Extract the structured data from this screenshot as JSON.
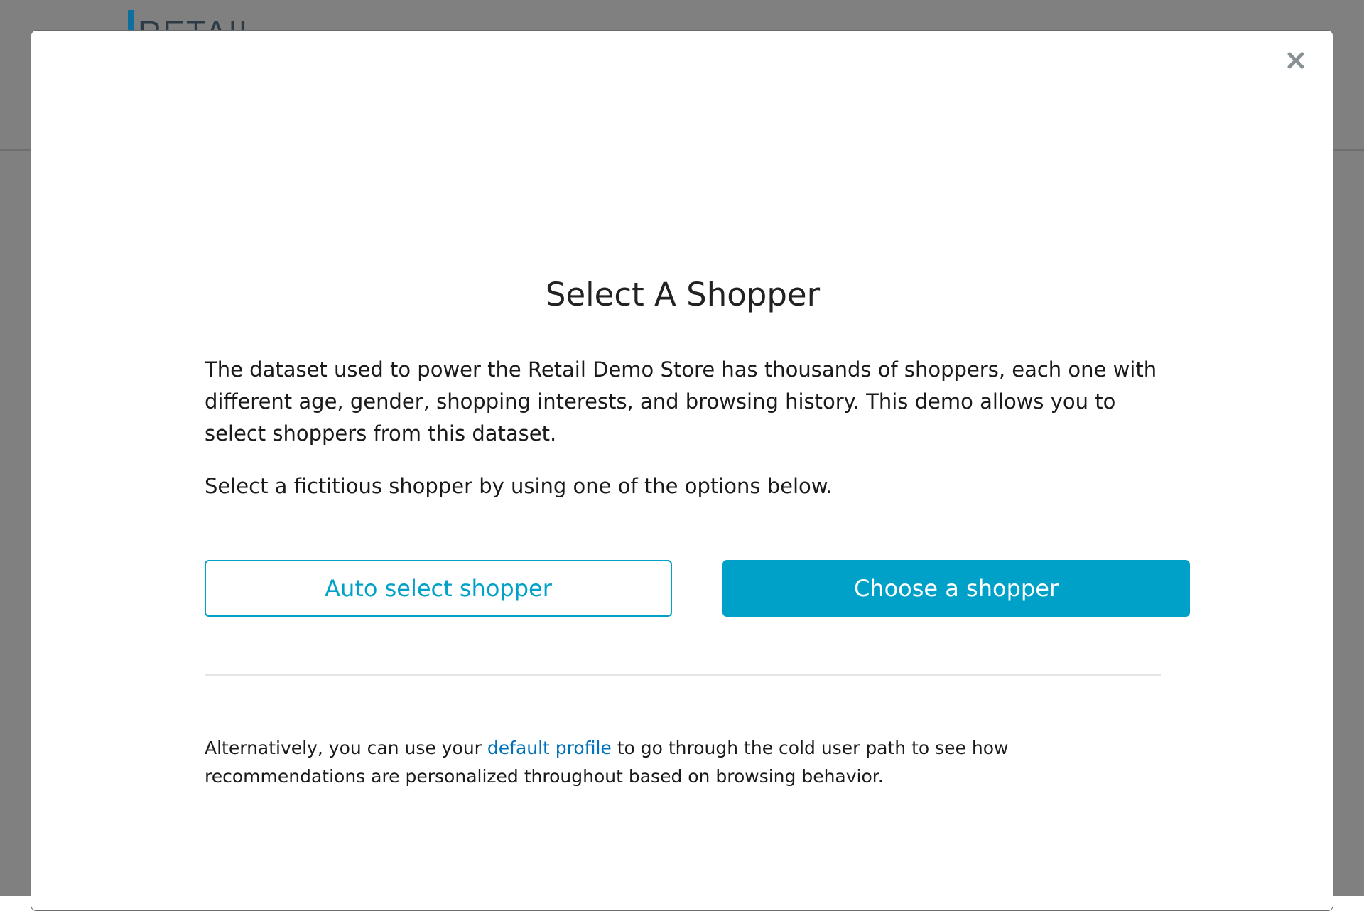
{
  "background": {
    "logo_text": "RETAIL"
  },
  "modal": {
    "close_icon": "close-icon",
    "title": "Select A Shopper",
    "description": "The dataset used to power the Retail Demo Store has thousands of shoppers, each one with different age, gender, shopping interests, and browsing history. This demo allows you to select shoppers from this dataset.",
    "instruction": "Select a fictitious shopper by using one of the options below.",
    "auto_select_label": "Auto select shopper",
    "choose_label": "Choose a shopper",
    "alternative": {
      "prefix": "Alternatively, you can use your ",
      "link_label": "default profile",
      "suffix": " to go through the cold user path to see how recommendations are personalized throughout based on browsing behavior."
    }
  },
  "colors": {
    "accent": "#00a1c9",
    "link": "#0073bb",
    "overlay": "#808080"
  }
}
